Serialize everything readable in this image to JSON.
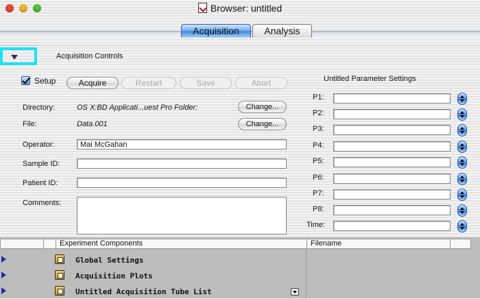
{
  "window": {
    "title": "Browser: untitled"
  },
  "tabs": [
    {
      "label": "Acquisition",
      "active": true
    },
    {
      "label": "Analysis",
      "active": false
    }
  ],
  "section": {
    "label": "Acquisition Controls"
  },
  "controls": {
    "setup_label": "Setup",
    "setup_checked": true,
    "buttons": {
      "acquire": "Acquire",
      "restart": "Restart",
      "save": "Save",
      "abort": "Abort"
    },
    "change_label": "Change..."
  },
  "form": {
    "directory_label": "Directory:",
    "directory_value": "OS X:BD Applicati...uest Pro Folder:",
    "file_label": "File:",
    "file_value": "Data.001",
    "operator_label": "Operator:",
    "operator_value": "Mai McGahan",
    "sample_label": "Sample ID:",
    "sample_value": "",
    "patient_label": "Patient ID:",
    "patient_value": "",
    "comments_label": "Comments:",
    "comments_value": ""
  },
  "params": {
    "title": "Untitled Parameter Settings",
    "labels": [
      "P1:",
      "P2:",
      "P3:",
      "P4:",
      "P5:",
      "P6:",
      "P7:",
      "P8:",
      "Time:"
    ]
  },
  "experiment": {
    "col_components": "Experiment Components",
    "col_filename": "Filename",
    "rows": [
      "Global Settings",
      "Acquisition Plots",
      "Untitled Acquisition Tube List"
    ]
  },
  "colors": {
    "highlight": "#19e3f4",
    "tab_active": "#3e86d8"
  }
}
